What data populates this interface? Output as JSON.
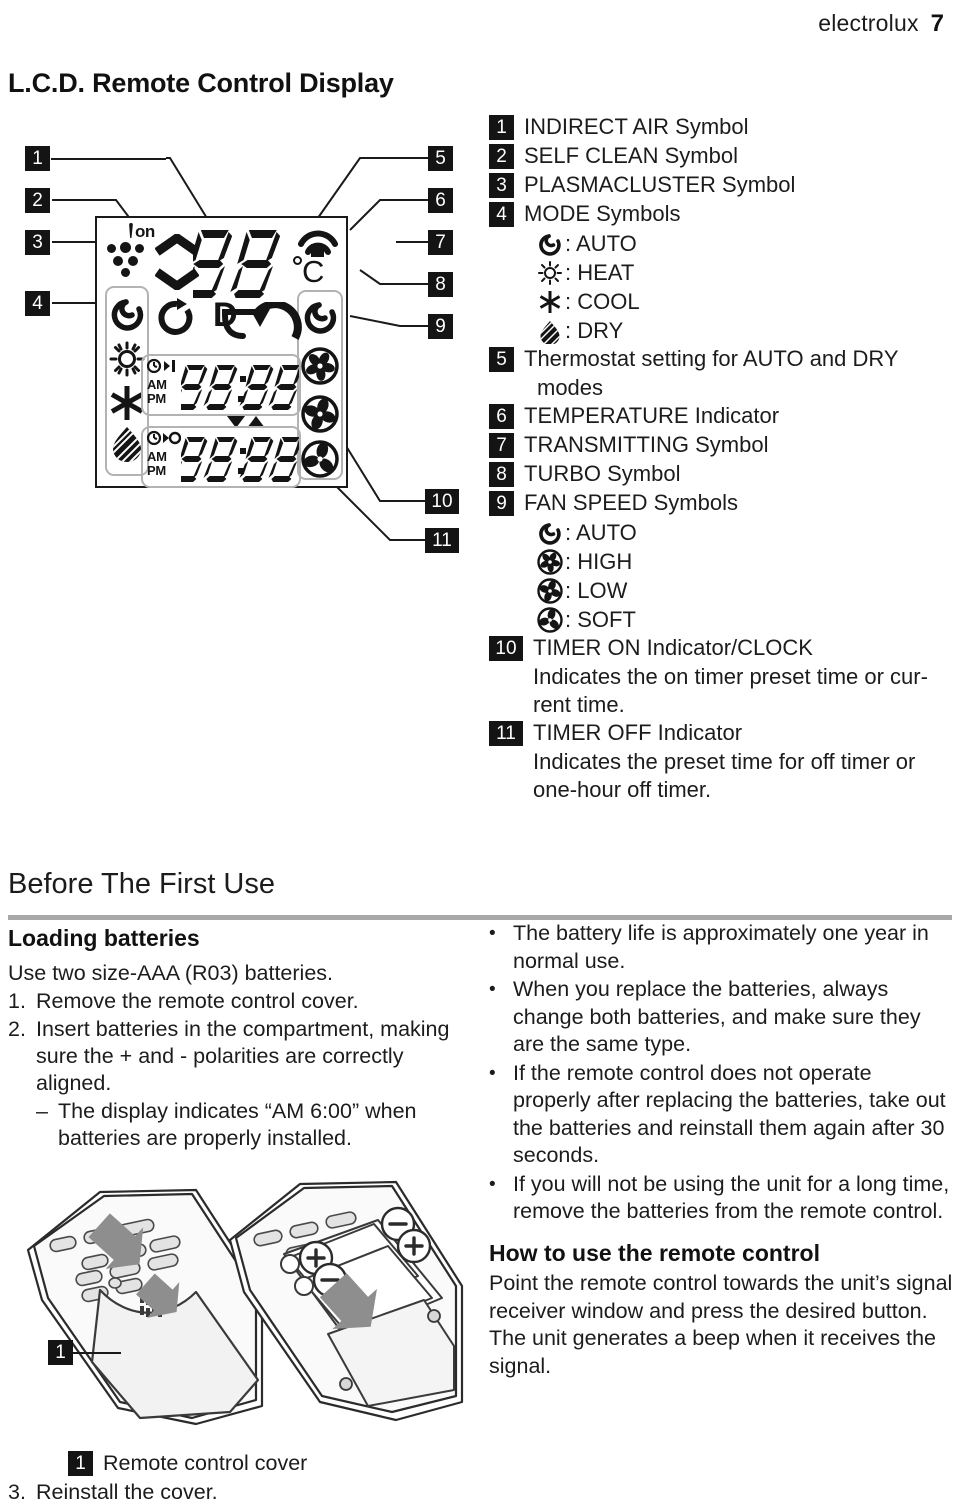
{
  "header": {
    "brand": "electrolux",
    "page": "7"
  },
  "lcd_section": {
    "title": "L.C.D. Remote Control Display",
    "left_callouts": [
      "1",
      "2",
      "3",
      "4"
    ],
    "right_callouts": [
      "5",
      "6",
      "7",
      "8",
      "9"
    ],
    "lower_callouts": [
      "10",
      "11"
    ],
    "display": {
      "plasmacluster_on": "on",
      "temperature_digits": "88",
      "unit": "C",
      "degree_symbol": "°",
      "timer_on": {
        "digits": "88",
        "digits2": "88",
        "colon": ":",
        "am": "AM",
        "pm": "PM"
      },
      "timer_off": {
        "digits": "88",
        "digits2": "88",
        "colon": ":",
        "am": "AM",
        "pm": "PM"
      }
    }
  },
  "legend": {
    "items": [
      {
        "num": "1",
        "text": "INDIRECT AIR Symbol"
      },
      {
        "num": "2",
        "text": "SELF CLEAN Symbol"
      },
      {
        "num": "3",
        "text": "PLASMACLUSTER Symbol"
      },
      {
        "num": "4",
        "text": "MODE Symbols"
      },
      {
        "num": "5",
        "text": "Thermostat setting for AUTO and DRY"
      },
      {
        "num": "6",
        "text": "TEMPERATURE Indicator"
      },
      {
        "num": "7",
        "text": "TRANSMITTING Symbol"
      },
      {
        "num": "8",
        "text": "TURBO Symbol"
      },
      {
        "num": "9",
        "text": "FAN SPEED Symbols"
      },
      {
        "num": "10",
        "text": "TIMER ON Indicator/CLOCK"
      },
      {
        "num": "11",
        "text": "TIMER OFF Indicator"
      }
    ],
    "mode_symbols": [
      {
        "icon": "auto-spiral-icon",
        "label": ": AUTO"
      },
      {
        "icon": "sun-icon",
        "label": ": HEAT"
      },
      {
        "icon": "snowflake-icon",
        "label": ": COOL"
      },
      {
        "icon": "droplet-icon",
        "label": ": DRY"
      }
    ],
    "item5_continuation": "modes",
    "fan_symbols": [
      {
        "icon": "auto-spiral-icon",
        "label": ": AUTO"
      },
      {
        "icon": "fan-high-icon",
        "label": ": HIGH"
      },
      {
        "icon": "fan-low-icon",
        "label": ": LOW"
      },
      {
        "icon": "fan-soft-icon",
        "label": ": SOFT"
      }
    ],
    "item10_desc": "Indicates the on timer preset time or cur-rent time.",
    "item10_desc_l1": "Indicates the on timer preset time or cur-",
    "item10_desc_l2": "rent time.",
    "item11_desc_l1": "Indicates the preset time for off timer or",
    "item11_desc_l2": "one-hour off timer."
  },
  "before_first_use": {
    "title": "Before The First Use",
    "subtitle_loading": "Loading batteries",
    "intro": "Use two size-AAA (R03) batteries.",
    "steps": [
      {
        "num": "1.",
        "text": "Remove the remote control cover."
      },
      {
        "num": "2.",
        "text": "Insert batteries in the compartment, making sure the + and - polarities are correctly aligned."
      }
    ],
    "dash_note": {
      "dash": "–",
      "text": "The display indicates “AM 6:00” when batteries are properly installed."
    },
    "bullets": [
      "The battery life is approximately one year in normal use.",
      "When you replace the batteries, always change both batteries, and make sure they are the same type.",
      "If the remote control does not operate properly after replacing the batteries, take out the batteries and reinstall them again after 30 seconds.",
      "If you will not be using the unit for a long time, remove the batteries from the remote control."
    ],
    "bullet_char": "•",
    "subtitle_howto": "How to use the remote control",
    "howto_body": "Point the remote control towards the unit’s signal receiver window and press the desired button. The unit generates a beep when it receives the signal."
  },
  "figure": {
    "cover_badge": "1",
    "cover_label": "Remote control cover",
    "step3": {
      "num": "3.",
      "text": "Reinstall the cover."
    },
    "battery_plus": "+",
    "battery_minus": "−"
  },
  "colors": {
    "ink": "#1a1a1a",
    "badge_bg": "#141414",
    "rule": "#a8a8a8",
    "lcd_pill": "#b3b3b3"
  }
}
